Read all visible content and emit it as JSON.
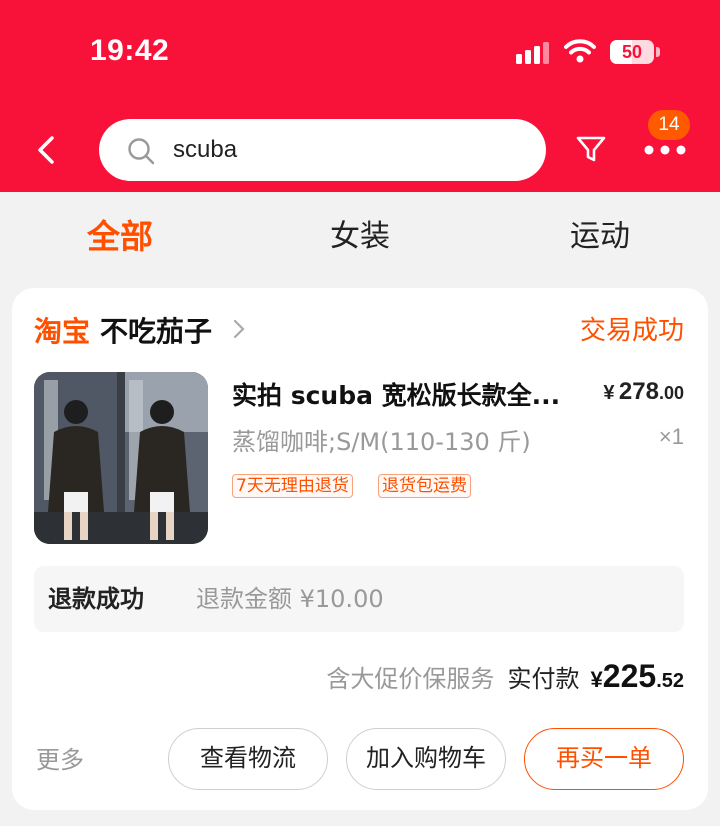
{
  "status_bar": {
    "time": "19:42",
    "battery": "50",
    "battery_level": 0.5
  },
  "search": {
    "query": "scuba",
    "notification_count": "14"
  },
  "tabs": [
    {
      "label": "全部",
      "active": true
    },
    {
      "label": "女装",
      "active": false
    },
    {
      "label": "运动",
      "active": false
    }
  ],
  "order": {
    "shop_logo": "淘宝",
    "shop_name": "不吃茄子",
    "status": "交易成功",
    "product": {
      "title": "实拍 scuba 宽松版长款全...",
      "sku": "蒸馏咖啡;S/M(110-130 斤)",
      "price_symbol": "¥",
      "price_int": "278",
      "price_dec": ".00",
      "quantity": "×1",
      "tags": [
        "7天无理由退货",
        "退货包运费"
      ]
    },
    "refund": {
      "status": "退款成功",
      "amount": "退款金额 ¥10.00"
    },
    "summary": {
      "service": "含大促价保服务",
      "paid_label": "实付款",
      "symbol": "¥",
      "int": "225",
      "dec": ".52"
    },
    "actions": {
      "more": "更多",
      "logistics": "查看物流",
      "add_cart": "加入购物车",
      "buy_again": "再买一单"
    }
  },
  "colors": {
    "header": "#f8123a",
    "accent": "#ff5000"
  }
}
